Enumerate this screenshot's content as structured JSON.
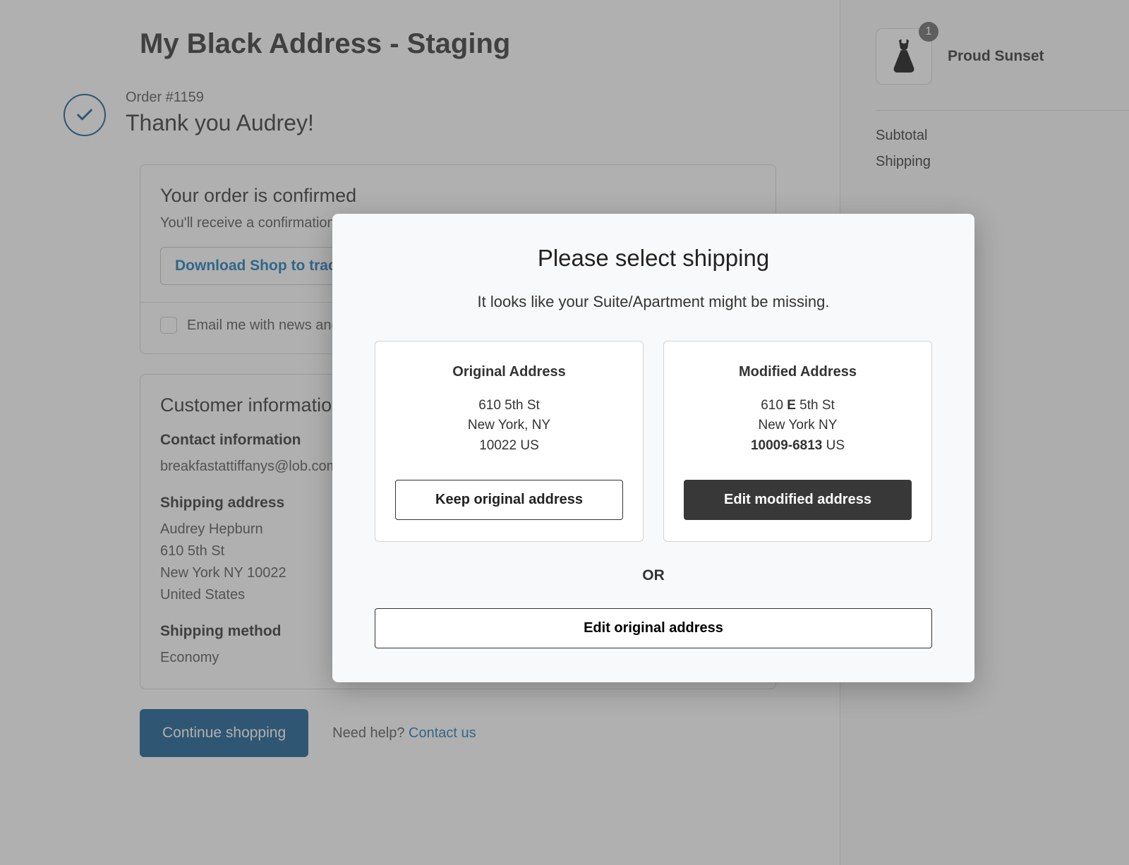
{
  "store_title": "My Black Address - Staging",
  "order": {
    "number_label": "Order #1159",
    "thank_you": "Thank you Audrey!"
  },
  "confirm_card": {
    "heading": "Your order is confirmed",
    "subtext": "You'll receive a confirmation email wit",
    "track_button": "Download Shop to track package",
    "news_checkbox_label": "Email me with news and offers"
  },
  "customer_info": {
    "heading": "Customer information",
    "contact_heading": "Contact information",
    "contact_email": "breakfastattiffanys@lob.com",
    "shipping_addr_heading": "Shipping address",
    "ship_name": "Audrey Hepburn",
    "ship_line1": "610 5th St",
    "ship_line2": "New York NY 10022",
    "ship_country": "United States",
    "shipping_method_heading": "Shipping method",
    "shipping_method": "Economy"
  },
  "footer": {
    "continue_label": "Continue shopping",
    "help_prefix": "Need help? ",
    "contact_label": "Contact us"
  },
  "sidebar": {
    "product_name": "Proud Sunset",
    "product_qty": "1",
    "subtotal_label": "Subtotal",
    "shipping_label": "Shipping"
  },
  "modal": {
    "title": "Please select shipping",
    "subtitle": "It looks like your Suite/Apartment might be missing.",
    "original": {
      "heading": "Original Address",
      "line1": "610 5th St",
      "line2": "New York, NY",
      "line3": "10022 US",
      "button": "Keep original address"
    },
    "modified": {
      "heading": "Modified Address",
      "line1_pre": "610 ",
      "line1_bold": "E",
      "line1_post": " 5th St",
      "line2": "New York NY",
      "line3_bold": "10009-6813",
      "line3_post": " US",
      "button": "Edit modified address"
    },
    "or_label": "OR",
    "edit_original_button": "Edit original address"
  }
}
